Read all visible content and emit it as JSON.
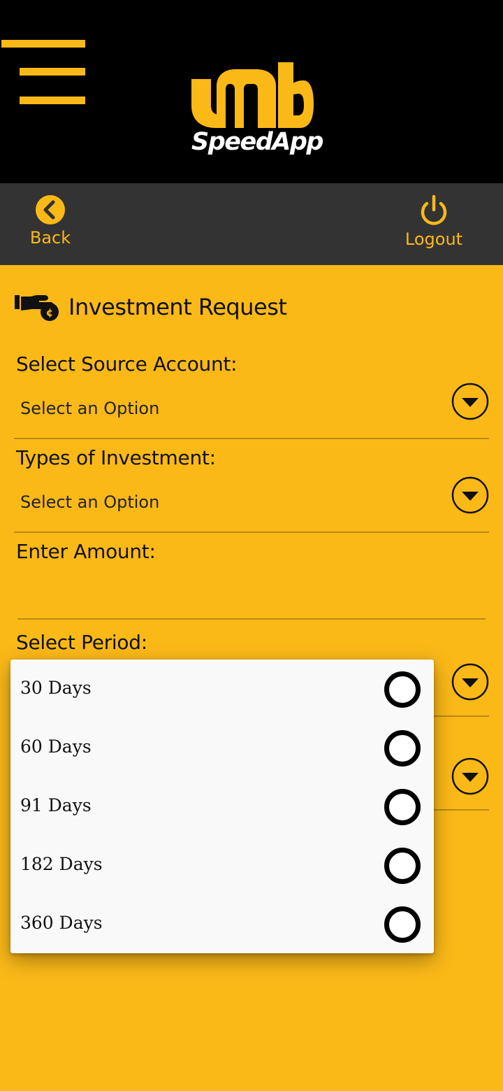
{
  "header": {
    "logo_text": "SpeedApp",
    "logo_mark": "umb"
  },
  "nav": {
    "back_label": "Back",
    "logout_label": "Logout"
  },
  "page": {
    "title": "Investment Request"
  },
  "form": {
    "source_account": {
      "label": "Select Source Account:",
      "value": "Select an Option"
    },
    "investment_type": {
      "label": "Types of Investment:",
      "value": "Select an Option"
    },
    "amount": {
      "label": "Enter Amount:",
      "value": ""
    },
    "period": {
      "label": "Select Period:"
    }
  },
  "period_popup": {
    "options": [
      {
        "label": "30 Days",
        "selected": false
      },
      {
        "label": "60 Days",
        "selected": false
      },
      {
        "label": "91 Days",
        "selected": false
      },
      {
        "label": "182 Days",
        "selected": false
      },
      {
        "label": "360 Days",
        "selected": false
      }
    ]
  },
  "colors": {
    "accent": "#fbb918",
    "header_bg": "#000000",
    "nav_bg": "#333333",
    "popup_bg": "#f9f9f9"
  },
  "icons": {
    "menu": "hamburger-menu-icon",
    "back": "chevron-left-circle-icon",
    "logout": "power-icon",
    "invest": "hand-coin-icon",
    "dropdown": "chevron-down-circle-icon"
  }
}
